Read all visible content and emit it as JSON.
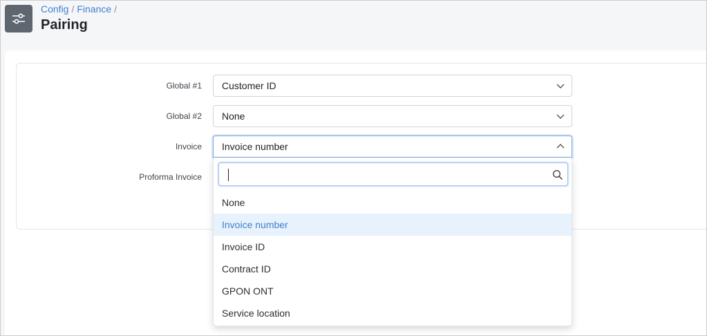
{
  "header": {
    "icon": "sliders-icon",
    "breadcrumb": [
      "Config",
      "Finance"
    ],
    "title": "Pairing"
  },
  "form": {
    "rows": [
      {
        "label": "Global #1",
        "value": "Customer ID"
      },
      {
        "label": "Global #2",
        "value": "None"
      },
      {
        "label": "Invoice",
        "value": "Invoice number"
      },
      {
        "label": "Proforma Invoice",
        "value": ""
      }
    ]
  },
  "dropdown": {
    "search_value": "",
    "options": [
      "None",
      "Invoice number",
      "Invoice ID",
      "Contract ID",
      "GPON ONT",
      "Service location"
    ],
    "selected": "Invoice number"
  },
  "colors": {
    "accent": "#3f7fcf",
    "selected_bg": "#e8f2fc",
    "icon_bg": "#5f6670"
  }
}
